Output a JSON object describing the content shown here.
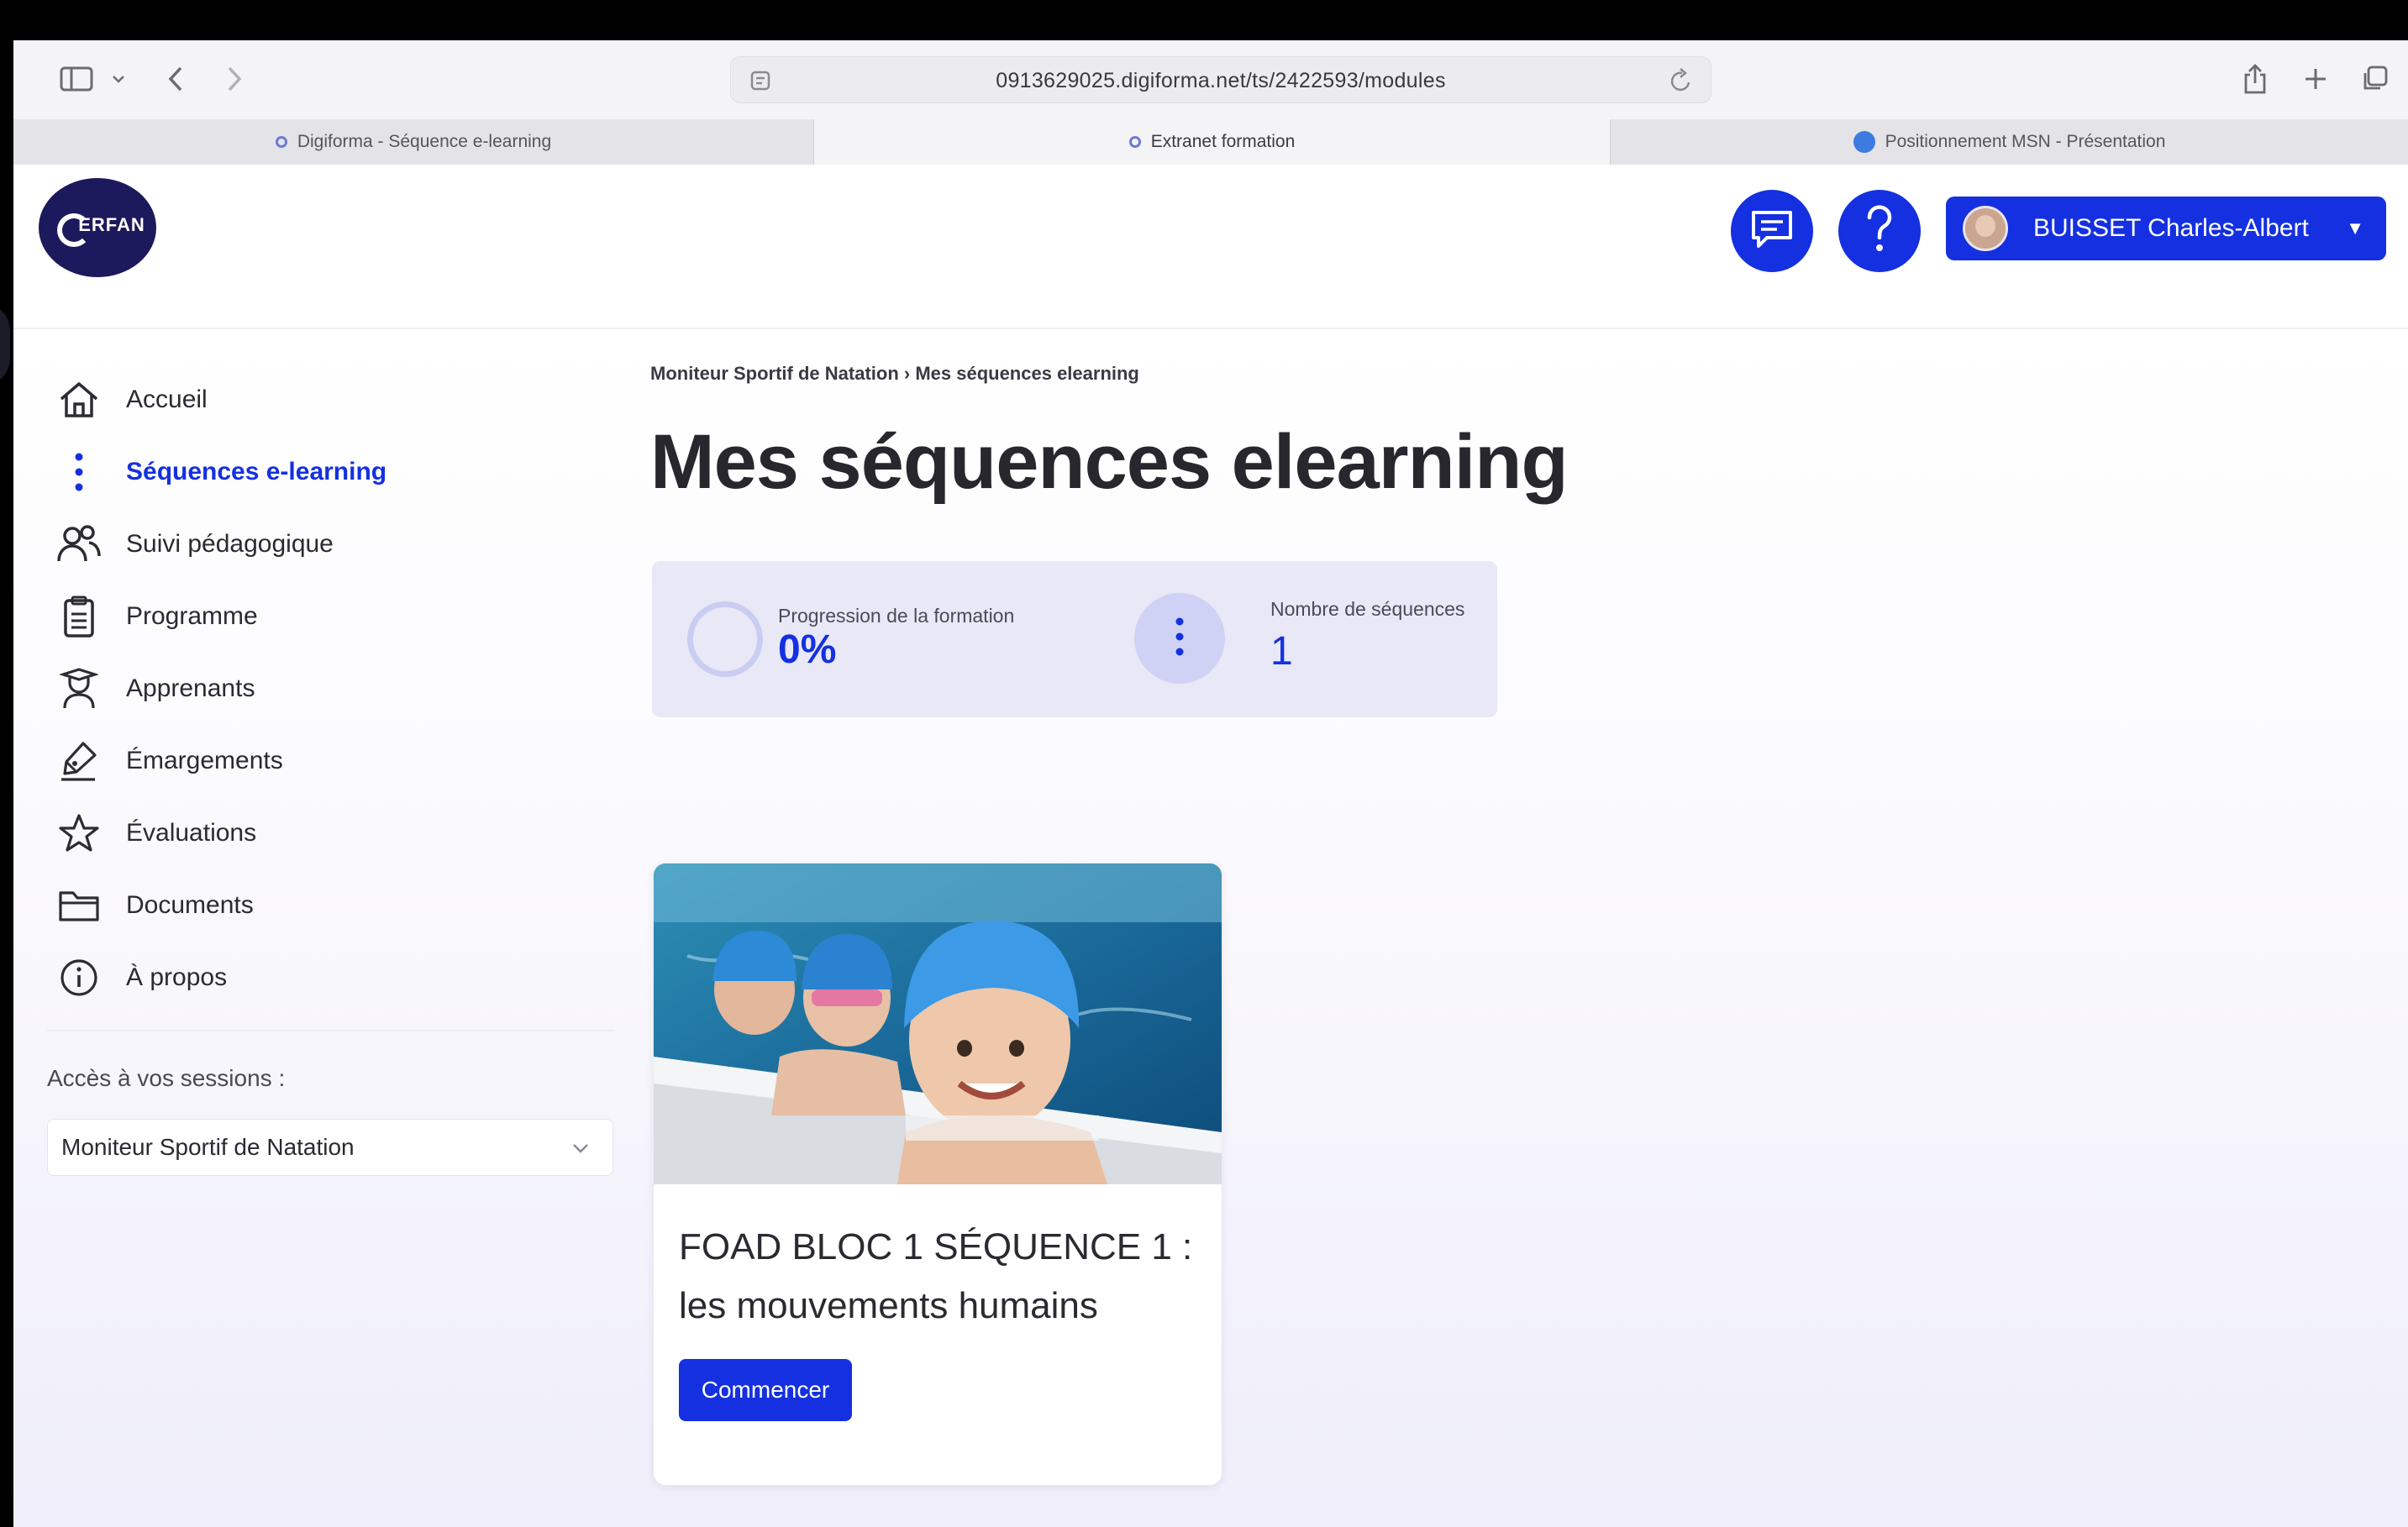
{
  "browser": {
    "url": "0913629025.digiforma.net/ts/2422593/modules",
    "tabs": [
      {
        "label": "Digiforma - Séquence e-learning",
        "active": false
      },
      {
        "label": "Extranet formation",
        "active": true
      },
      {
        "label": "Positionnement MSN - Présentation",
        "active": false
      }
    ]
  },
  "header": {
    "logo_text": "ERFAN",
    "user_name": "BUISSET Charles-Albert",
    "icons": [
      "chat-icon",
      "help-icon"
    ]
  },
  "sidebar": {
    "items": [
      {
        "label": "Accueil",
        "icon": "home-icon"
      },
      {
        "label": "Séquences e-learning",
        "icon": "vertical-dots-icon",
        "active": true
      },
      {
        "label": "Suivi pédagogique",
        "icon": "users-icon"
      },
      {
        "label": "Programme",
        "icon": "clipboard-icon"
      },
      {
        "label": "Apprenants",
        "icon": "learner-icon"
      },
      {
        "label": "Émargements",
        "icon": "signature-icon"
      },
      {
        "label": "Évaluations",
        "icon": "star-icon"
      },
      {
        "label": "Documents",
        "icon": "folder-icon"
      },
      {
        "label": "À propos",
        "icon": "info-icon"
      }
    ],
    "sessions_label": "Accès à vos sessions :",
    "session_selected": "Moniteur Sportif de Natation"
  },
  "main": {
    "breadcrumb": "Moniteur Sportif de Natation › Mes séquences elearning",
    "title": "Mes séquences elearning",
    "stats": {
      "progress_label": "Progression de la formation",
      "progress_value": "0%",
      "sequences_label": "Nombre de séquences",
      "sequences_value": "1"
    },
    "modules": [
      {
        "title": "FOAD BLOC 1 SÉQUENCE 1 : les mouvements humains",
        "button_label": "Commencer"
      }
    ]
  },
  "colors": {
    "accent": "#1430e0",
    "sidebar_active": "#1430e0",
    "stats_bg": "#e8e8f6"
  }
}
